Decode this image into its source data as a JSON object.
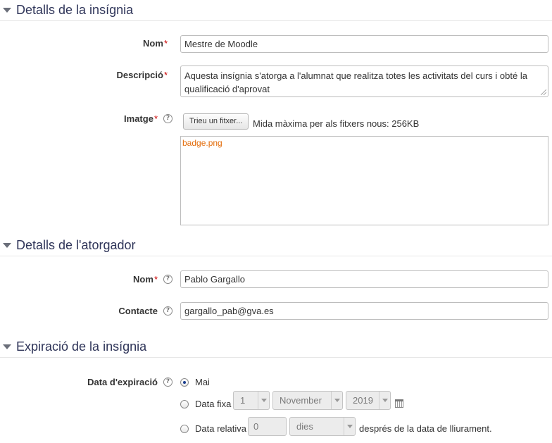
{
  "sections": {
    "badge_details": {
      "title": "Detalls de la insígnia"
    },
    "issuer_details": {
      "title": "Detalls de l'atorgador"
    },
    "expiry": {
      "title": "Expiració de la insígnia"
    }
  },
  "badge": {
    "name_label": "Nom",
    "name_value": "Mestre de Moodle",
    "description_label": "Descripció",
    "description_value": "Aquesta insígnia s'atorga a l'alumnat que realitza totes les activitats del curs i obté la qualificació d'aprovat",
    "image_label": "Imatge",
    "choose_file_button": "Trieu un fitxer...",
    "max_size_hint": "Mida màxima per als fitxers nous: 256KB",
    "file_name": "badge.png"
  },
  "issuer": {
    "name_label": "Nom",
    "name_value": "Pablo Gargallo",
    "contact_label": "Contacte",
    "contact_value": "gargallo_pab@gva.es"
  },
  "expiry": {
    "label": "Data d'expiració",
    "option_never": "Mai",
    "option_fixed": "Data fixa",
    "option_relative": "Data relativa",
    "selected": "Mai",
    "day": "1",
    "month": "November",
    "year": "2019",
    "relative_amount": "0",
    "relative_unit": "dies",
    "after_text": "després de la data de lliurament."
  },
  "required_mark": "*",
  "help_glyph": "?"
}
